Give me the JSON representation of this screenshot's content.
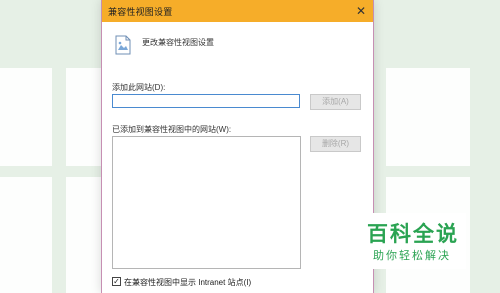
{
  "dialog": {
    "title": "兼容性视图设置",
    "close_glyph": "✕",
    "header_text": "更改兼容性视图设置",
    "add_site_label": "添加此网站(D):",
    "add_site_value": "",
    "add_button": "添加(A)",
    "list_label": "已添加到兼容性视图中的网站(W):",
    "remove_button": "删除(R)",
    "intranet_checkbox_label": "在兼容性视图中显示 Intranet 站点(I)",
    "intranet_checked": true,
    "check_glyph": "✓"
  },
  "watermark": {
    "title": "百科全说",
    "subtitle": "助你轻松解决"
  },
  "colors": {
    "titlebar": "#f6ad29",
    "watermark_green": "#2aa352",
    "background": "#e6f0e6"
  }
}
